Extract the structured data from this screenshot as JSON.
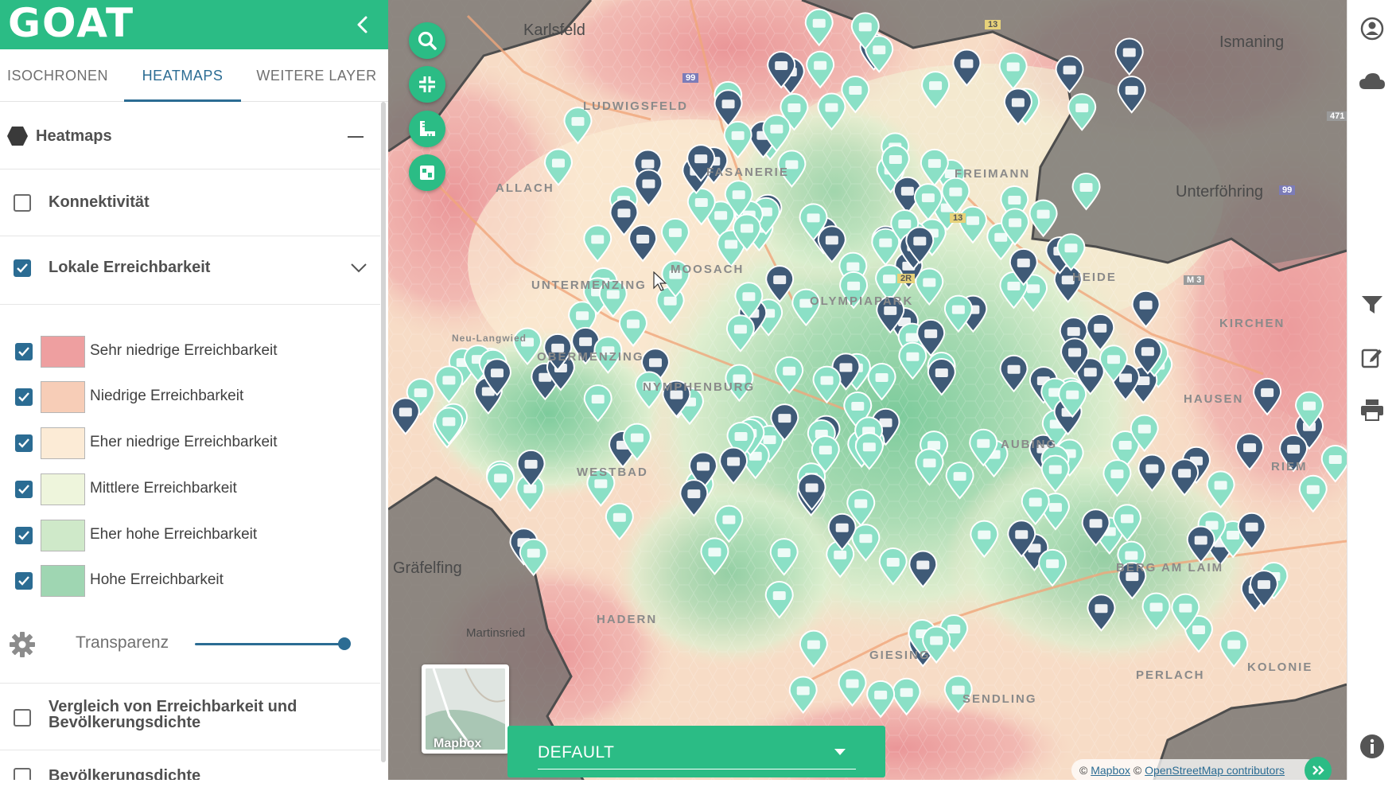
{
  "app": {
    "logo": "GOAT"
  },
  "tabs": [
    {
      "label": "ISOCHRONEN"
    },
    {
      "label": "HEATMAPS"
    },
    {
      "label": "WEITERE LAYER"
    }
  ],
  "heatmaps_section": {
    "title": "Heatmaps"
  },
  "layers": {
    "konnektivitaet": {
      "label": "Konnektivität",
      "checked": false
    },
    "lokale": {
      "label": "Lokale Erreichbarkeit",
      "checked": true
    },
    "vergleich": {
      "label_line1": "Vergleich von Erreichbarkeit und",
      "label_line2": "Bevölkerungsdichte",
      "checked": false
    },
    "bevoelkerung": {
      "label": "Bevölkerungsdichte",
      "checked": false
    }
  },
  "legend": [
    {
      "label": "Sehr niedrige Erreichbarkeit",
      "color": "#ee9fa0",
      "checked": true
    },
    {
      "label": "Niedrige Erreichbarkeit",
      "color": "#f7cdb7",
      "checked": true
    },
    {
      "label": "Eher niedrige Erreichbarkeit",
      "color": "#fcebd6",
      "checked": true
    },
    {
      "label": "Mittlere Erreichbarkeit",
      "color": "#eef5dc",
      "checked": true
    },
    {
      "label": "Eher hohe Erreichbarkeit",
      "color": "#cfe9c9",
      "checked": true
    },
    {
      "label": "Hohe Erreichbarkeit",
      "color": "#9fd6b2",
      "checked": true
    }
  ],
  "transparency": {
    "label": "Transparenz",
    "value": 1.0
  },
  "map": {
    "labels": [
      "LUDWIGSFELD",
      "FASANERIE",
      "ALLACH",
      "UNTERMENZING",
      "MOOSACH",
      "OBERMENZING",
      "NYMPHENBURG",
      "WESTBAD",
      "HADERN",
      "FREIMANN",
      "OLYMPIAPARK",
      "AUBING",
      "SENDLING",
      "GIESING",
      "PERLACH",
      "BERG AM LAIM",
      "KIRCHEN",
      "HAUSEN",
      "HEIDE",
      "KOLONIE",
      "RIEM"
    ],
    "towns": [
      "Karlsfeld",
      "Ismaning",
      "Unterföhring",
      "Gräfelfing",
      "Martinsried",
      "Neu-Langwied"
    ],
    "road_numbers": [
      "99",
      "13",
      "13",
      "2R",
      "M 3",
      "99",
      "471"
    ],
    "style_selector": {
      "value": "DEFAULT"
    },
    "basemap": {
      "label": "Mapbox"
    },
    "attribution": {
      "prefix": "©",
      "mapbox": "Mapbox",
      "sep": "©",
      "osm": "OpenStreetMap contributors"
    }
  },
  "colors": {
    "brand": "#2bbc85",
    "accent": "#2b6c93",
    "outside_area": "#6f6e6c",
    "pin_supermarket": "#8be0c6",
    "pin_shop": "#3f5a77"
  },
  "icons": {
    "search": "search-icon",
    "fullscreen": "fullscreen-icon",
    "measure": "ruler-icon",
    "layers": "layers-icon",
    "user": "user-icon",
    "cloud": "cloud-icon",
    "filter": "filter-icon",
    "edit": "edit-icon",
    "print": "print-icon",
    "info": "info-icon"
  }
}
